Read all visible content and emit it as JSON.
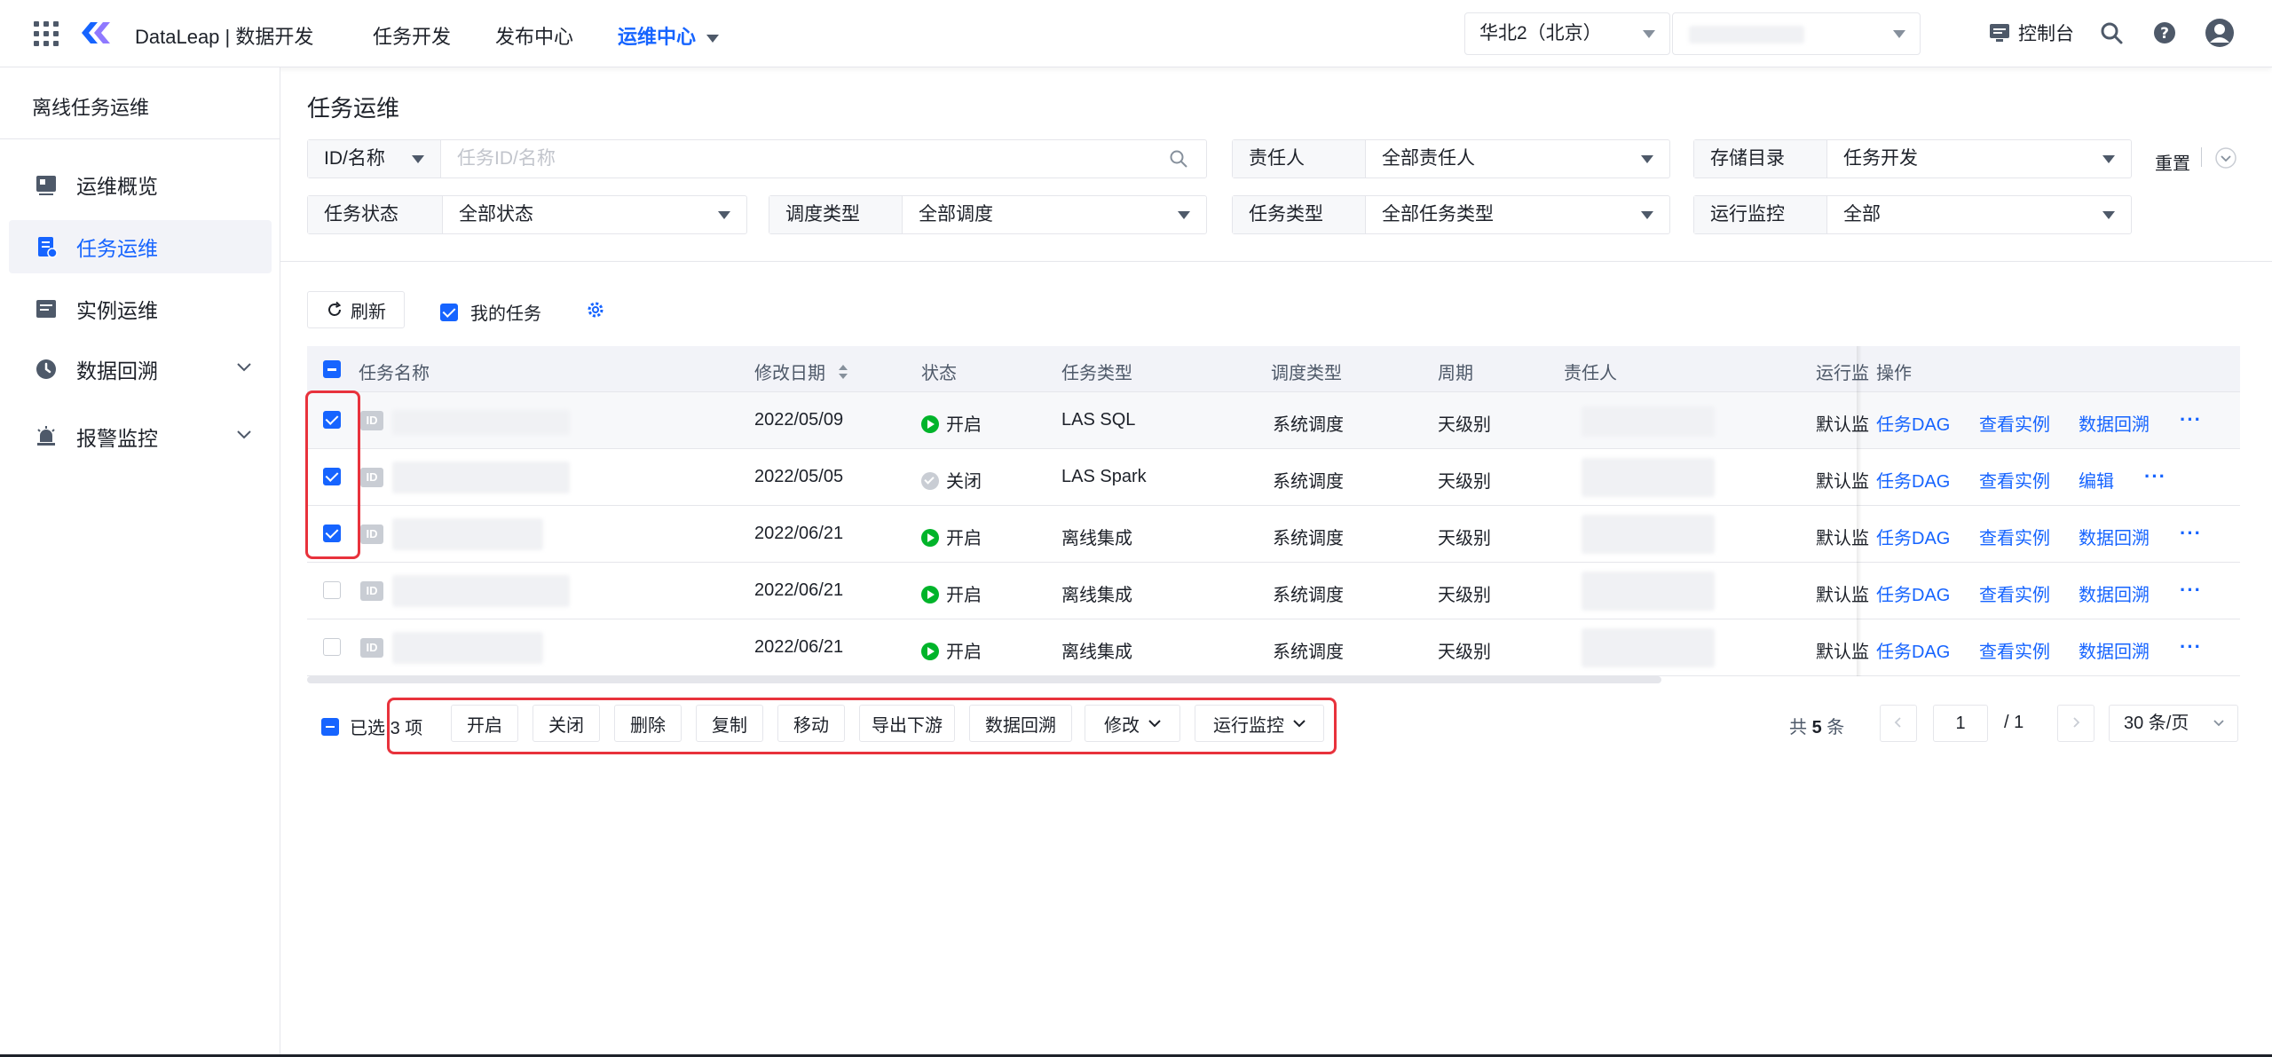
{
  "topbar": {
    "brand": "DataLeap | 数据开发",
    "nav": [
      {
        "label": "任务开发"
      },
      {
        "label": "发布中心"
      },
      {
        "label": "运维中心"
      }
    ],
    "region": "华北2（北京）",
    "console": "控制台"
  },
  "sidebar": {
    "title": "离线任务运维",
    "items": [
      {
        "label": "运维概览"
      },
      {
        "label": "任务运维"
      },
      {
        "label": "实例运维"
      },
      {
        "label": "数据回溯"
      },
      {
        "label": "报警监控"
      }
    ]
  },
  "page": {
    "title": "任务运维",
    "filters": {
      "id_type": "ID/名称",
      "id_placeholder": "任务ID/名称",
      "owner_label": "责任人",
      "owner_value": "全部责任人",
      "storage_label": "存储目录",
      "storage_value": "任务开发",
      "status_label": "任务状态",
      "status_value": "全部状态",
      "schedule_label": "调度类型",
      "schedule_value": "全部调度",
      "tasktype_label": "任务类型",
      "tasktype_value": "全部任务类型",
      "monitor_label": "运行监控",
      "monitor_value": "全部"
    },
    "reset": "重置",
    "refresh": "刷新",
    "my_tasks": "我的任务"
  },
  "table": {
    "headers": {
      "name": "任务名称",
      "modified": "修改日期",
      "status": "状态",
      "task_type": "任务类型",
      "schedule_type": "调度类型",
      "cycle": "周期",
      "owner": "责任人",
      "monitor": "运行监",
      "actions": "操作"
    },
    "id_tag": "ID",
    "rows": [
      {
        "date": "2022/05/09",
        "status": "开启",
        "task_type": "LAS SQL",
        "schedule": "系统调度",
        "cycle": "天级别",
        "monitor": "默认监",
        "actions": [
          "任务DAG",
          "查看实例",
          "数据回溯"
        ],
        "checked": true
      },
      {
        "date": "2022/05/05",
        "status": "关闭",
        "task_type": "LAS Spark",
        "schedule": "系统调度",
        "cycle": "天级别",
        "monitor": "默认监",
        "actions": [
          "任务DAG",
          "查看实例",
          "编辑"
        ],
        "checked": true
      },
      {
        "date": "2022/06/21",
        "status": "开启",
        "task_type": "离线集成",
        "schedule": "系统调度",
        "cycle": "天级别",
        "monitor": "默认监",
        "actions": [
          "任务DAG",
          "查看实例",
          "数据回溯"
        ],
        "checked": true
      },
      {
        "date": "2022/06/21",
        "status": "开启",
        "task_type": "离线集成",
        "schedule": "系统调度",
        "cycle": "天级别",
        "monitor": "默认监",
        "actions": [
          "任务DAG",
          "查看实例",
          "数据回溯"
        ],
        "checked": false
      },
      {
        "date": "2022/06/21",
        "status": "开启",
        "task_type": "离线集成",
        "schedule": "系统调度",
        "cycle": "天级别",
        "monitor": "默认监",
        "actions": [
          "任务DAG",
          "查看实例",
          "数据回溯"
        ],
        "checked": false
      }
    ],
    "more": "···"
  },
  "bulk": {
    "selected_prefix": "已选",
    "selected_count": "3",
    "selected_suffix": "项",
    "buttons": [
      "开启",
      "关闭",
      "删除",
      "复制",
      "移动",
      "导出下游",
      "数据回溯",
      "修改",
      "运行监控"
    ]
  },
  "pager": {
    "total_prefix": "共",
    "total": "5",
    "total_suffix": "条",
    "page": "1",
    "pages": "/   1",
    "page_size": "30 条/页"
  },
  "colors": {
    "accent": "#1664ff",
    "success": "#00b42a",
    "highlight_box": "#e8323c"
  }
}
